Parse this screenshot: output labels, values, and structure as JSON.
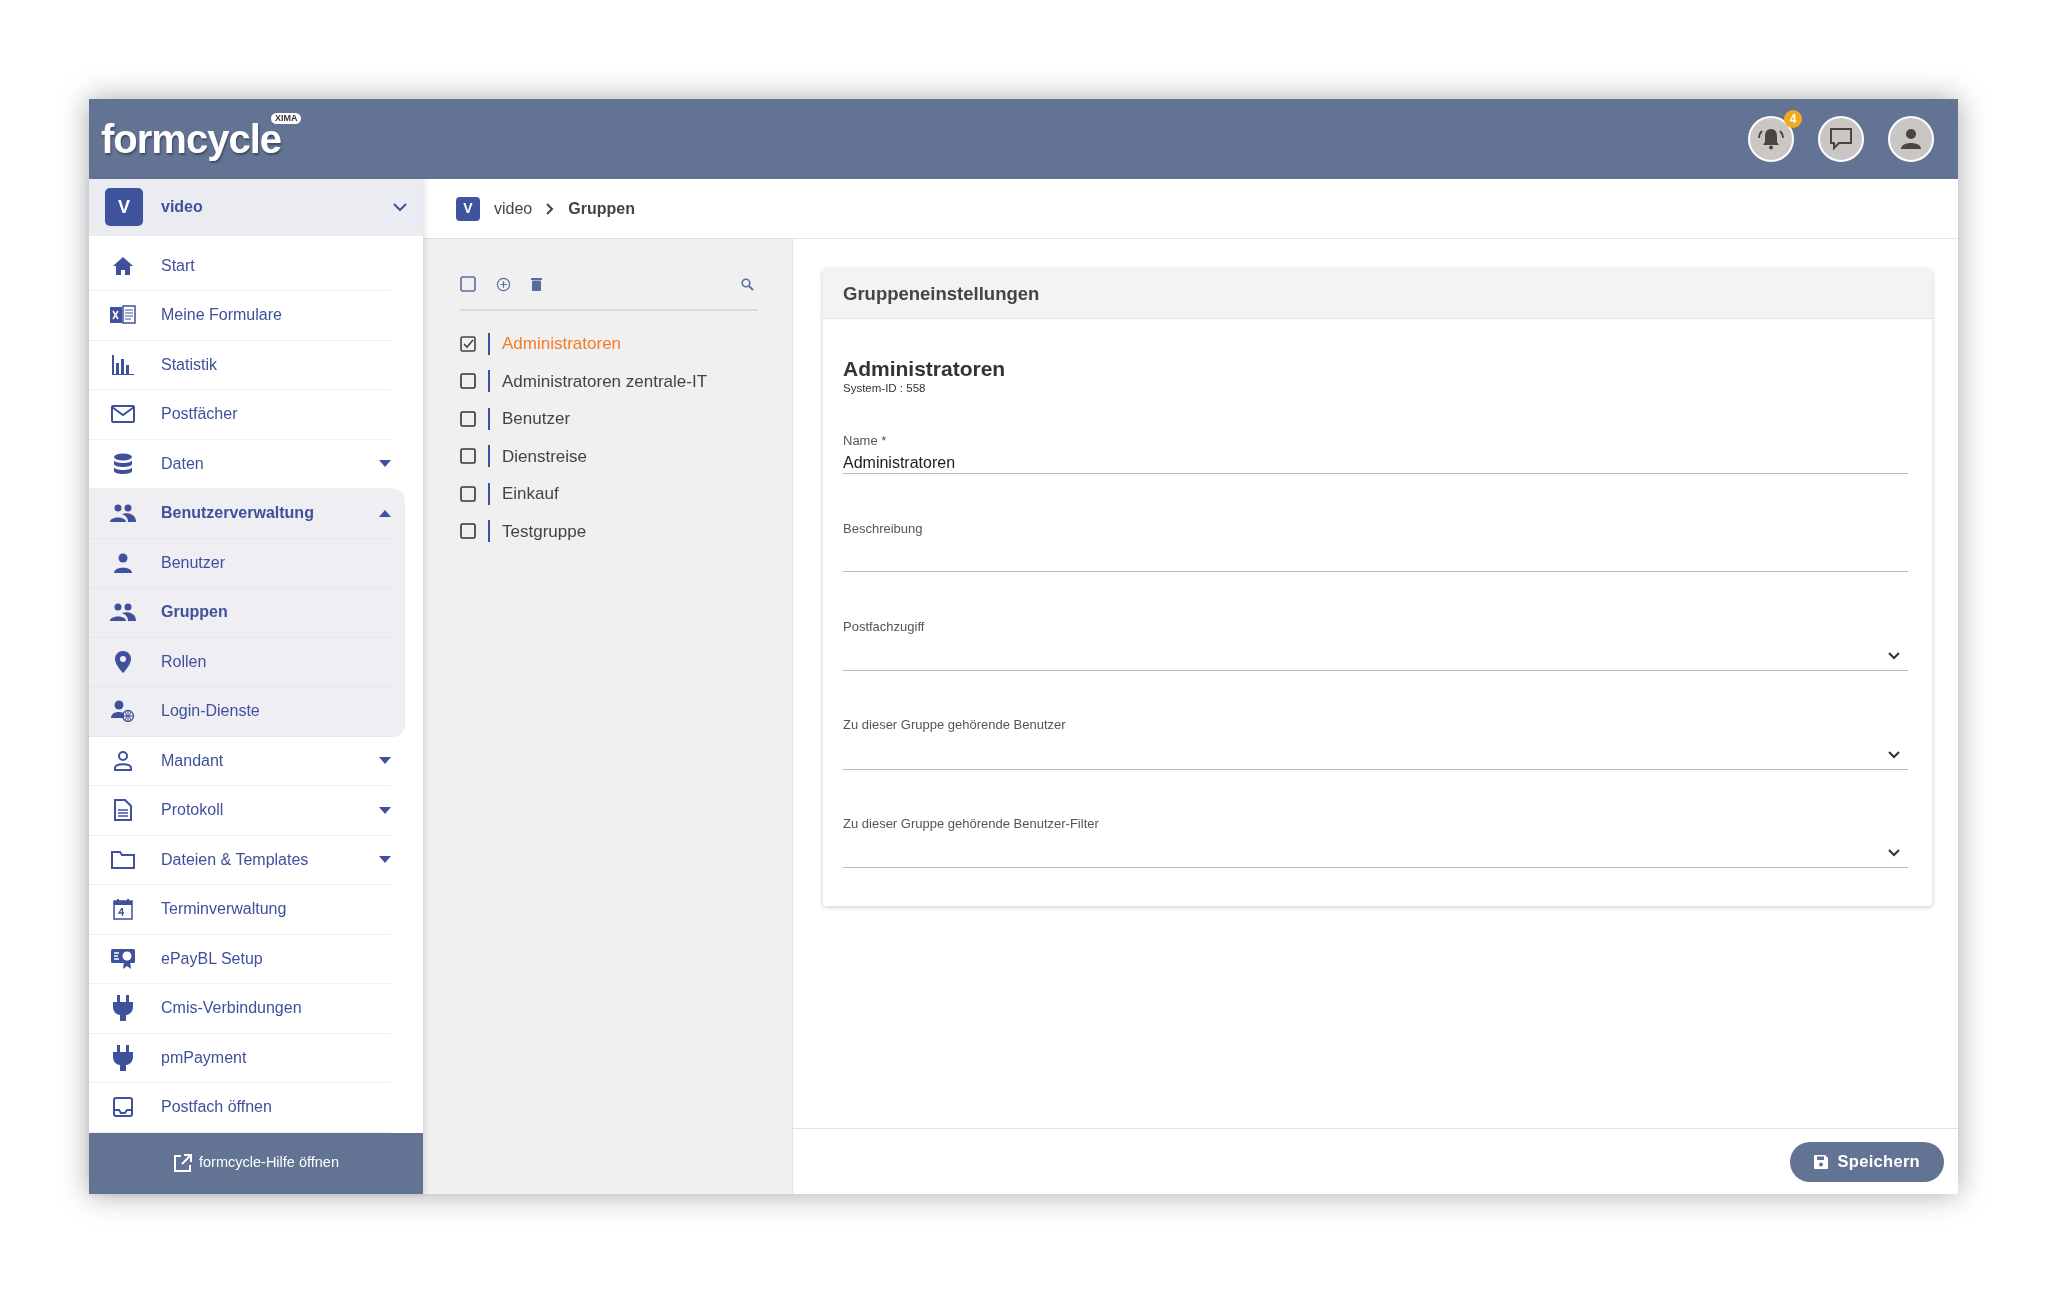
{
  "app": {
    "logo": "formcycle",
    "logo_badge": "XIMA",
    "notification_count": "4"
  },
  "sidebar": {
    "project": {
      "initial": "V",
      "name": "video"
    },
    "items": [
      {
        "label": "Start",
        "selected": false
      },
      {
        "label": "Meine Formulare",
        "selected": false
      },
      {
        "label": "Statistik",
        "selected": false
      },
      {
        "label": "Postfächer",
        "selected": false
      },
      {
        "label": "Daten",
        "selected": false,
        "expanded": false
      },
      {
        "label": "Benutzerverwaltung",
        "expanded": true,
        "children": [
          {
            "label": "Benutzer",
            "selected": false
          },
          {
            "label": "Gruppen",
            "selected": true
          },
          {
            "label": "Rollen",
            "selected": false
          },
          {
            "label": "Login-Dienste",
            "selected": false
          }
        ]
      },
      {
        "label": "Mandant",
        "selected": false,
        "expanded": false
      },
      {
        "label": "Protokoll",
        "selected": false,
        "expanded": false
      },
      {
        "label": "Dateien & Templates",
        "selected": false,
        "expanded": false
      },
      {
        "label": "Terminverwaltung",
        "selected": false
      },
      {
        "label": "ePayBL Setup",
        "selected": false
      },
      {
        "label": "Cmis-Verbindungen",
        "selected": false
      },
      {
        "label": "pmPayment",
        "selected": false
      },
      {
        "label": "Postfach öffnen",
        "selected": false
      }
    ],
    "help_link": "formcycle-Hilfe öffnen"
  },
  "breadcrumb": {
    "initial": "V",
    "items": [
      "video",
      "Gruppen"
    ]
  },
  "group_list": {
    "items": [
      {
        "label": "Administratoren",
        "checked": true,
        "selected": true
      },
      {
        "label": "Administratoren zentrale-IT",
        "checked": false,
        "selected": false
      },
      {
        "label": "Benutzer",
        "checked": false,
        "selected": false
      },
      {
        "label": "Dienstreise",
        "checked": false,
        "selected": false
      },
      {
        "label": "Einkauf",
        "checked": false,
        "selected": false
      },
      {
        "label": "Testgruppe",
        "checked": false,
        "selected": false
      }
    ]
  },
  "settings": {
    "panel_title": "Gruppeneinstellungen",
    "title": "Administratoren",
    "system_id": "System-ID : 558",
    "fields": [
      {
        "kind": "text",
        "label": "Name *",
        "value": "Administratoren"
      },
      {
        "kind": "text",
        "label": "Beschreibung"
      },
      {
        "kind": "select",
        "label": "Postfachzugiff"
      },
      {
        "kind": "select",
        "label": "Zu dieser Gruppe gehörende Benutzer"
      },
      {
        "kind": "select",
        "label": "Zu dieser Gruppe gehörende Benutzer-Filter"
      }
    ]
  },
  "save_button": "Speichern"
}
